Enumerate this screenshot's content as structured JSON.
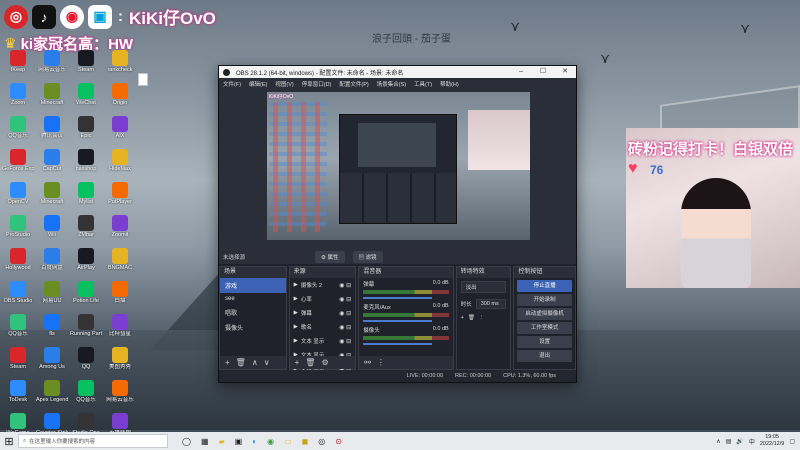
{
  "overlay": {
    "streamer_name": "KiKi仔OvO",
    "sub_text": "ki家冠名高：HW",
    "song_text": "浪子回頭 - 茄子蛋",
    "follow_text": "砖粉记得打卡！白银双倍",
    "heart_count": "76",
    "colors": {
      "accent_pink": "#d12f84",
      "brand_red": "#d8262a"
    },
    "social_icons": [
      "netease-music-icon",
      "tiktok-icon",
      "weibo-icon",
      "bilibili-icon"
    ]
  },
  "desktop": {
    "icons": [
      "IKeep",
      "网易云音乐",
      "Steam",
      "rankcheck",
      "Zoom",
      "Minecraft",
      "WeChat",
      "Origin",
      "QQ音乐",
      "腾讯会议",
      "Epic",
      "AIX",
      "GeForce Experience",
      "CapCut",
      "hasshop",
      "HideMax",
      "OpenCV",
      "Minecraft",
      "Mylist",
      "PotPlayer",
      "ProStudio",
      "Wii",
      "ZMbar",
      "Zoomit",
      "Hollywood",
      "百度网盘",
      "AirPlay",
      "BNGMAC",
      "OBS Studio",
      "网易UU",
      "Potion Life",
      "白描",
      "QQ音乐",
      "fls",
      "Running Party",
      "比特彗星",
      "Steam",
      "Among Us",
      "QQ",
      "美图秀秀",
      "ToDesk",
      "Apex Legends",
      "QQ音乐",
      "网易云音乐",
      "WeGame",
      "Counter-Strike",
      "Studio One",
      "英雄联盟"
    ]
  },
  "obs": {
    "title": "OBS 28.1.2 (64-bit, windows) - 配置文件: 未命名 - 场景: 未命名",
    "window_controls": [
      "–",
      "☐",
      "✕"
    ],
    "menu": [
      "文件(F)",
      "编辑(E)",
      "视图(V)",
      "停靠窗口(D)",
      "配置文件(P)",
      "场景集合(S)",
      "工具(T)",
      "帮助(H)"
    ],
    "no_source_selected": "未选择源",
    "properties_btn": "属性",
    "filters_btn": "滤镜",
    "preview_tag": "KiKi仔OvO",
    "docks": {
      "scenes": {
        "title": "场景",
        "items": [
          "游戏",
          "see",
          "唱歌",
          "摄像头"
        ],
        "active_index": 0
      },
      "sources": {
        "title": "来源",
        "items": [
          "摄像头 2",
          "心率",
          "弹幕",
          "歌名",
          "文本 显示",
          "文本 显示",
          "文本 显示"
        ]
      },
      "mixer": {
        "title": "混音器",
        "channels": [
          {
            "name": "弹幕",
            "db": "0.0 dB"
          },
          {
            "name": "麦克风/Aux",
            "db": "0.0 dB"
          },
          {
            "name": "摄像头",
            "db": "0.0 dB"
          }
        ]
      },
      "transitions": {
        "title": "转场特效",
        "type": "淡出",
        "duration_label": "时长",
        "duration": "300 ms"
      },
      "controls": {
        "title": "控制按钮",
        "buttons": [
          "停止直播",
          "开始录制",
          "启动虚拟摄像机",
          "工作室模式",
          "设置",
          "退出"
        ],
        "active_index": 0
      }
    },
    "status": {
      "live": "LIVE: 00:00:00",
      "rec": "REC: 00:00:00",
      "cpu": "CPU: 1.3%, 60.00 fps"
    }
  },
  "taskbar": {
    "search_placeholder": "在这里输入你要搜索的内容",
    "time": "19:05",
    "date": "2022/12/9",
    "lang": "中"
  }
}
